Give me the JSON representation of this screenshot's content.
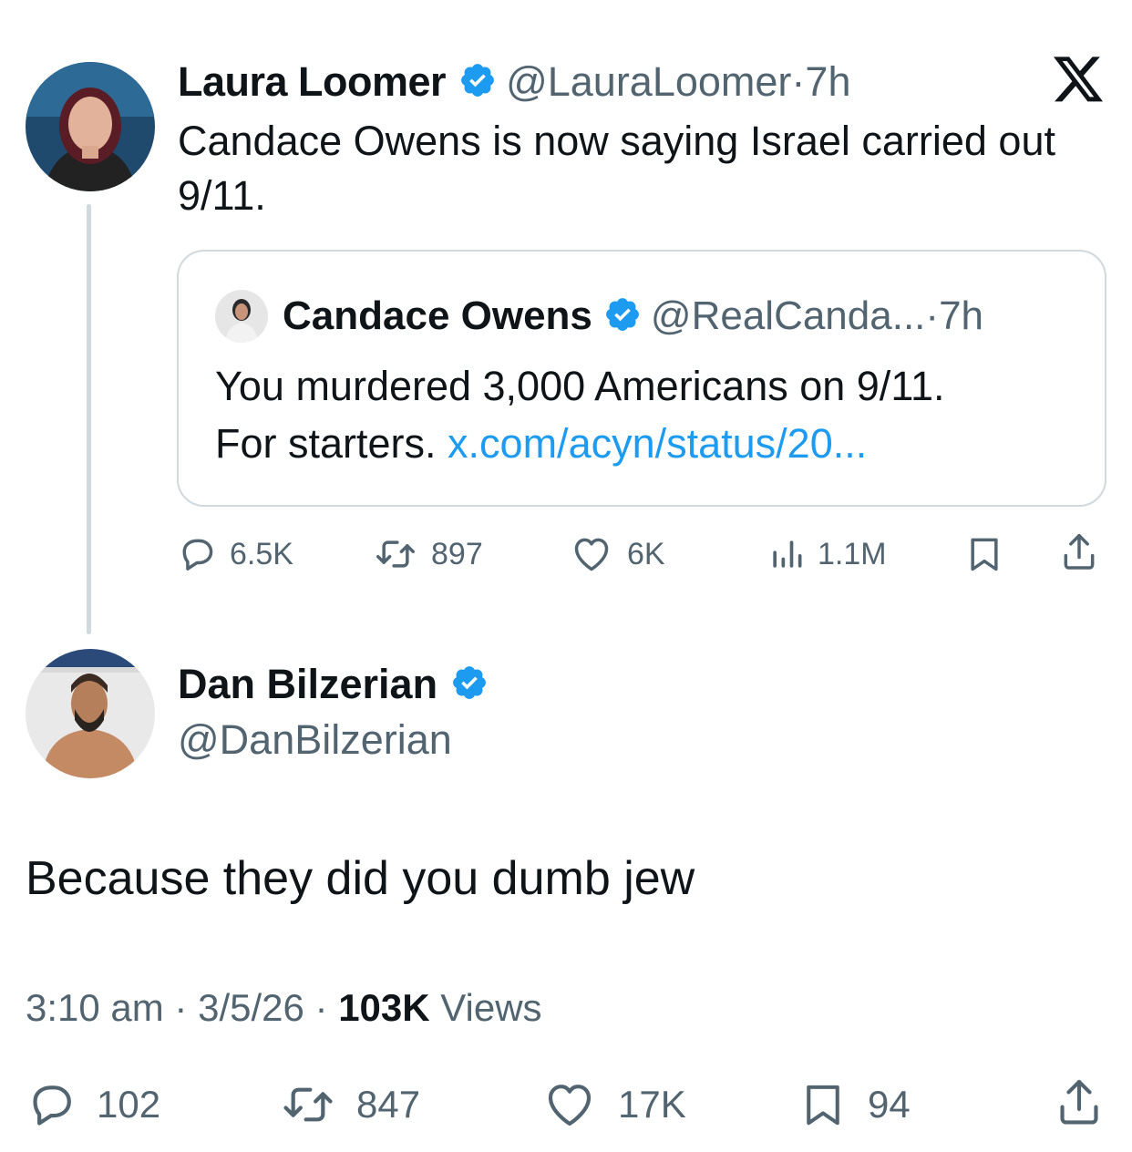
{
  "parent": {
    "name": "Laura Loomer",
    "handle": "@LauraLoomer",
    "separator": " · ",
    "time": "7h",
    "text_line1": "Candace Owens is now saying Israel carried out",
    "text_line2": "9/11.",
    "avatar_icon": "profile-photo",
    "actions": {
      "replies": "6.5K",
      "reposts": "897",
      "likes": "6K",
      "views": "1.1M"
    }
  },
  "quote": {
    "name": "Candace Owens",
    "handle": "@RealCanda...",
    "separator": " · ",
    "time": "7h",
    "text_line1": "You murdered 3,000 Americans on 9/11.",
    "text_line2": "For starters. ",
    "link": "x.com/acyn/status/20..."
  },
  "reply": {
    "name": "Dan Bilzerian",
    "handle": "@DanBilzerian",
    "text": "Because they did you dumb jew",
    "meta": {
      "time": "3:10 am",
      "sep1": " · ",
      "date": "3/5/26",
      "sep2": " · ",
      "views_count": "103K",
      "views_label": " Views"
    },
    "actions": {
      "replies": "102",
      "reposts": "847",
      "likes": "17K",
      "bookmarks": "94"
    }
  },
  "colors": {
    "verified_badge": "#1d9bf0",
    "link": "#1d9bf0",
    "muted_text": "#536471",
    "border": "#cfd9de"
  }
}
